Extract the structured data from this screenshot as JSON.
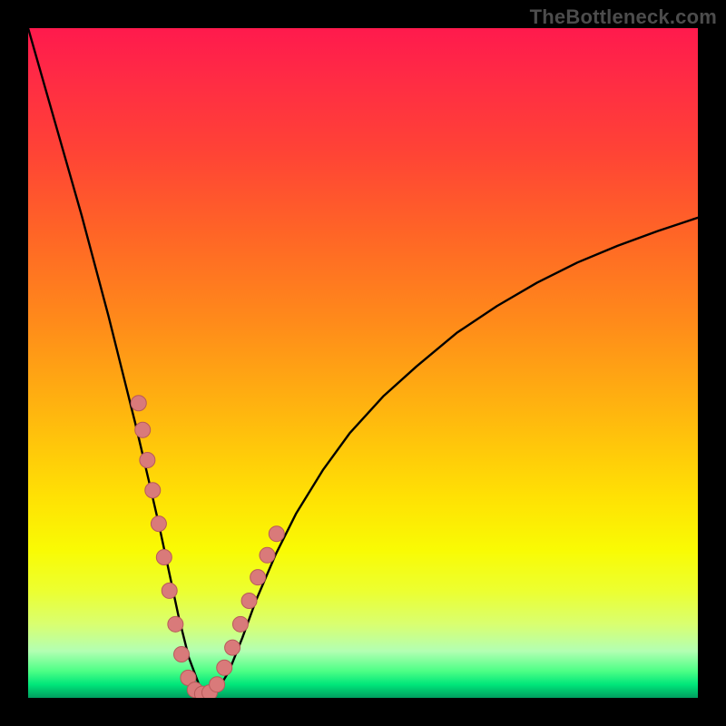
{
  "watermark": "TheBottleneck.com",
  "colors": {
    "background": "#000000",
    "curve": "#000000",
    "dot_fill": "#d97a7a",
    "dot_stroke": "#b85a5a",
    "gradient_top": "#ff1a4d",
    "gradient_bottom": "#009e5f"
  },
  "chart_data": {
    "type": "line",
    "title": "",
    "xlabel": "",
    "ylabel": "",
    "xlim": [
      0,
      100
    ],
    "ylim": [
      0,
      100
    ],
    "grid": false,
    "legend": false,
    "curve": {
      "x": [
        0,
        2,
        4,
        6,
        8,
        10,
        12,
        14,
        16,
        18,
        19.5,
        21,
        22.5,
        24,
        25.5,
        27,
        28.5,
        30,
        32,
        34,
        37,
        40,
        44,
        48,
        53,
        58,
        64,
        70,
        76,
        82,
        88,
        94,
        100
      ],
      "y": [
        100,
        93,
        86,
        79,
        72,
        64.5,
        57,
        49,
        41,
        32.5,
        26,
        19,
        12,
        6,
        2,
        0.5,
        1.5,
        4,
        9,
        14.5,
        21.5,
        27.5,
        34,
        39.5,
        45,
        49.5,
        54.5,
        58.5,
        62,
        65,
        67.5,
        69.7,
        71.7
      ]
    },
    "series": [
      {
        "name": "left-branch-dots",
        "x": [
          16.5,
          17.1,
          17.8,
          18.6,
          19.5,
          20.3,
          21.1,
          22.0,
          22.9,
          23.9,
          24.9,
          26.0
        ],
        "y": [
          44.0,
          40.0,
          35.5,
          31.0,
          26.0,
          21.0,
          16.0,
          11.0,
          6.5,
          3.0,
          1.2,
          0.6
        ]
      },
      {
        "name": "right-branch-dots",
        "x": [
          27.1,
          28.2,
          29.3,
          30.5,
          31.7,
          33.0,
          34.3,
          35.7,
          37.1
        ],
        "y": [
          0.8,
          2.0,
          4.5,
          7.5,
          11.0,
          14.5,
          18.0,
          21.3,
          24.5
        ]
      }
    ]
  }
}
